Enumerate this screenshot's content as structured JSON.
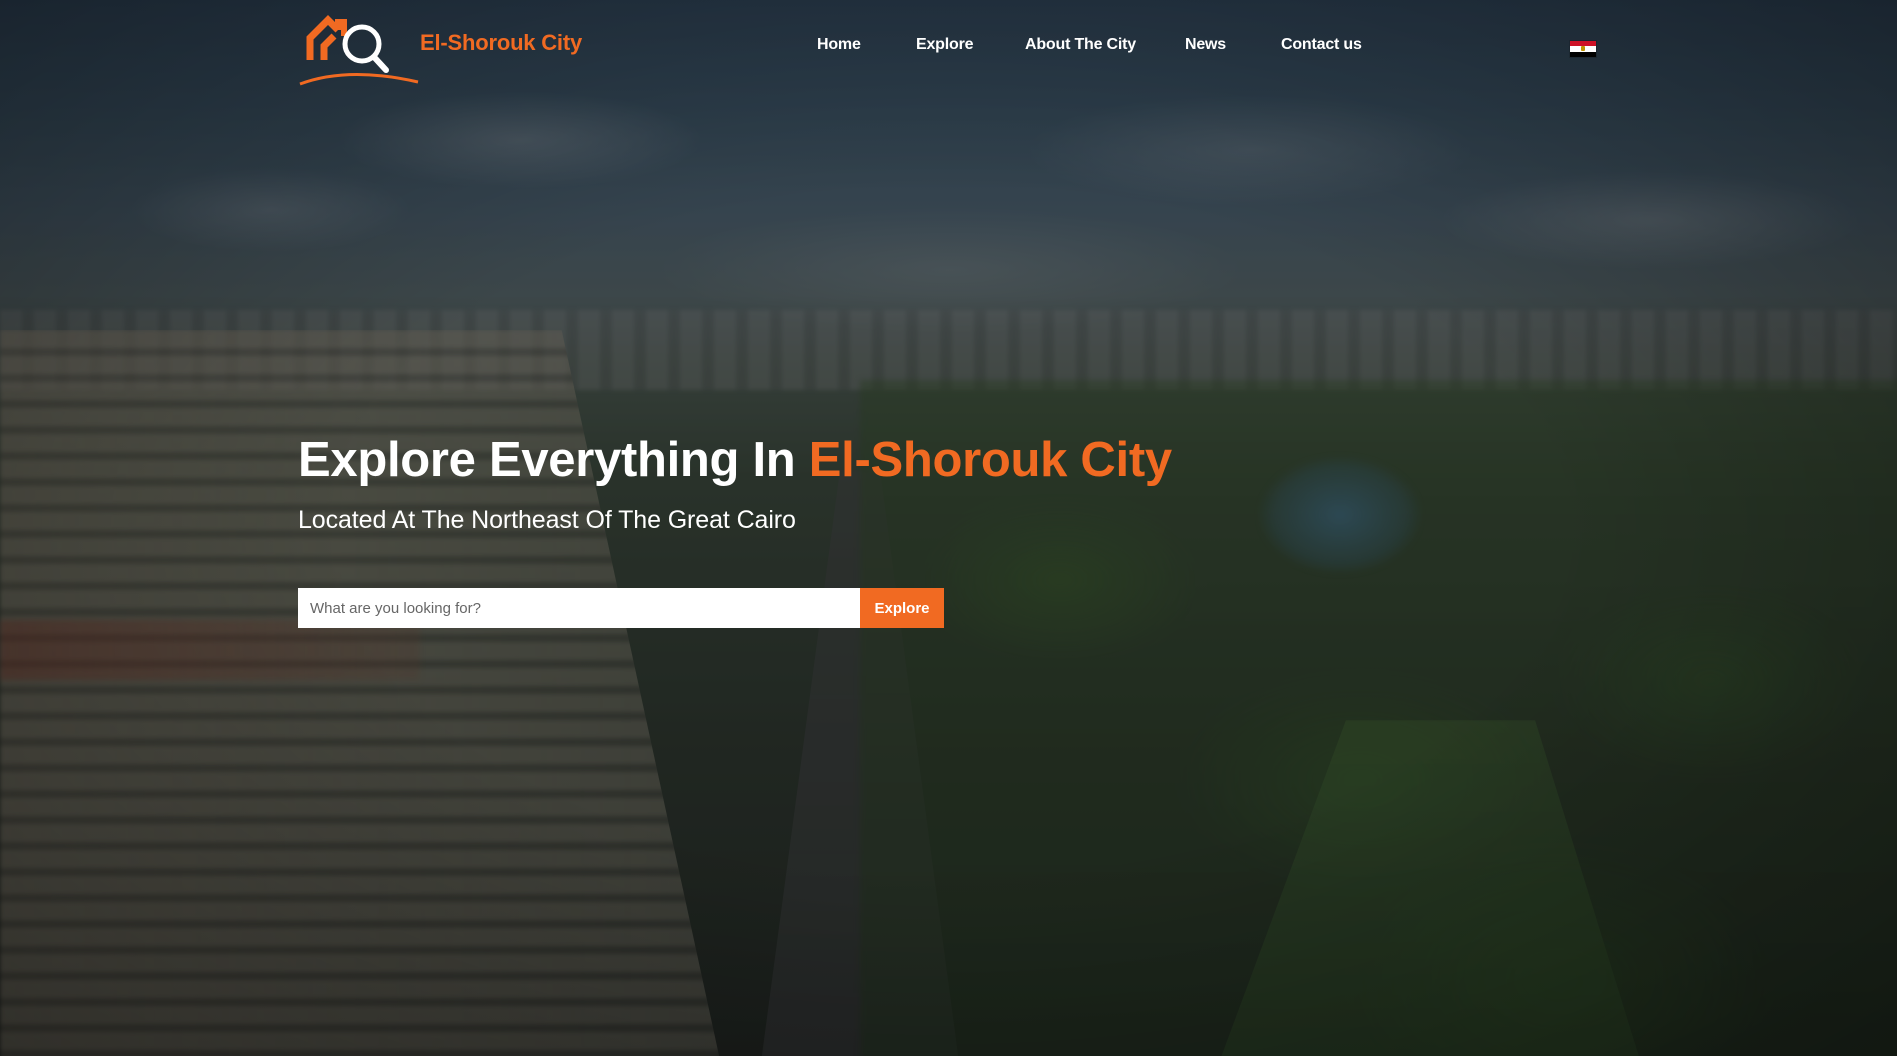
{
  "brand": {
    "name": "El-Shorouk City",
    "accent_color": "#f16a22",
    "logo_icon": "house-search-icon"
  },
  "nav": {
    "items": [
      {
        "label": "Home"
      },
      {
        "label": "Explore"
      },
      {
        "label": "About The City"
      },
      {
        "label": "News"
      },
      {
        "label": "Contact us"
      }
    ],
    "language_icon": "egypt-flag-icon"
  },
  "hero": {
    "title_prefix": "Explore Everything In",
    "title_accent": "El-Shorouk City",
    "subtitle": "Located At The Northeast Of The Great Cairo",
    "background": "aerial-city-photo"
  },
  "search": {
    "placeholder": "What are you looking for?",
    "value": "",
    "button_label": "Explore"
  }
}
